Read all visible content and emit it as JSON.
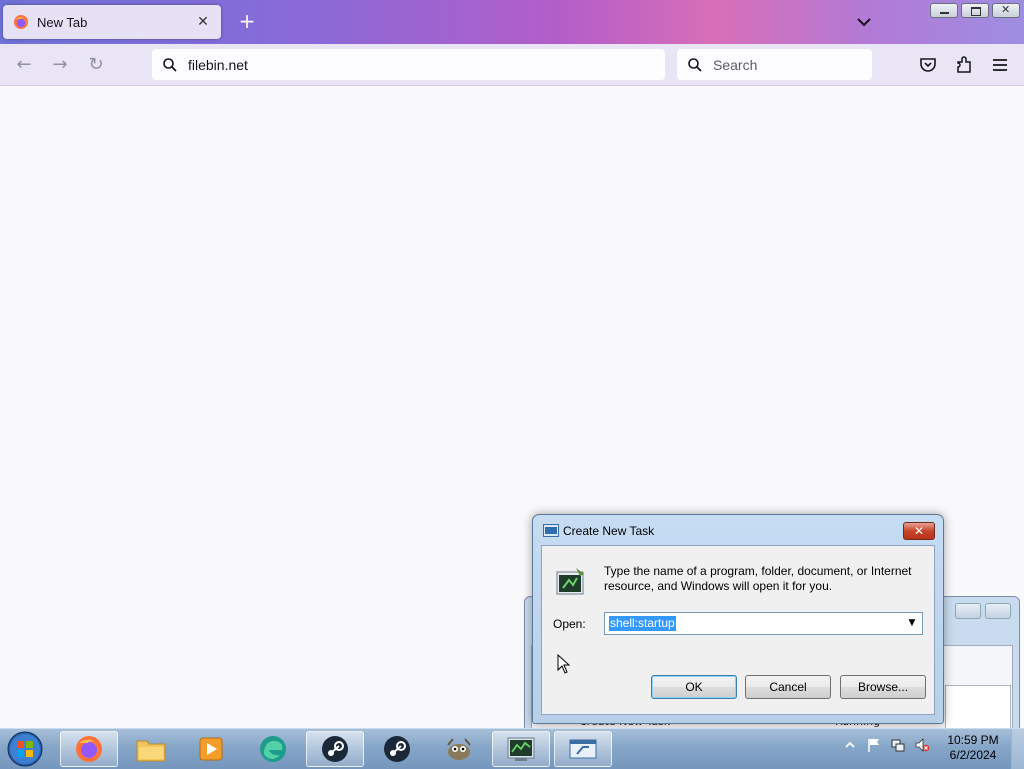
{
  "browser": {
    "tab_title": "New Tab",
    "url": "filebin.net",
    "search_placeholder": "Search"
  },
  "background_window": {
    "row_text": "Create New Task",
    "status_text": "Running"
  },
  "dialog": {
    "title": "Create New Task",
    "close_label": "✕",
    "description": "Type the name of a program, folder, document, or Internet resource, and Windows will open it for you.",
    "open_label": "Open:",
    "open_value": "shell:startup",
    "ok_label": "OK",
    "cancel_label": "Cancel",
    "browse_label": "Browse..."
  },
  "taskbar": {
    "time": "10:59 PM",
    "date": "6/2/2024",
    "apps": [
      "firefox-icon",
      "file-explorer-icon",
      "media-player-icon",
      "edge-browser-icon",
      "steam-icon",
      "steam-icon",
      "gimp-icon",
      "task-manager-icon",
      "run-dialog-icon"
    ]
  }
}
